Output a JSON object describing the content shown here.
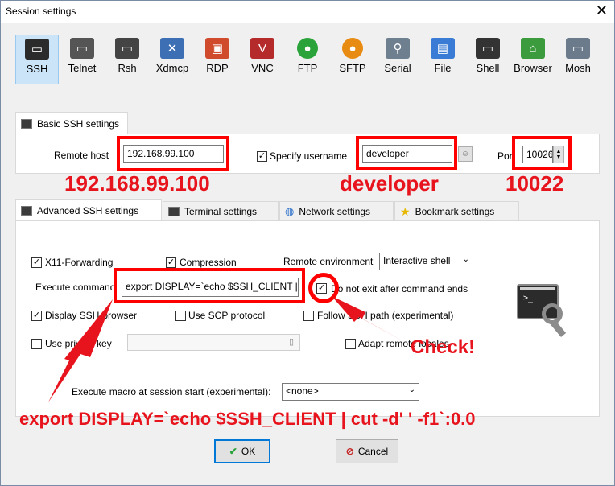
{
  "window": {
    "title": "Session settings",
    "close_glyph": "✕"
  },
  "session_types": [
    {
      "label": "SSH",
      "icon": "ssh-icon",
      "color": "#2b2b2b"
    },
    {
      "label": "Telnet",
      "icon": "telnet-icon",
      "color": "#555555"
    },
    {
      "label": "Rsh",
      "icon": "rsh-icon",
      "color": "#444444"
    },
    {
      "label": "Xdmcp",
      "icon": "xdmcp-icon",
      "color": "#3d6fb5"
    },
    {
      "label": "RDP",
      "icon": "rdp-icon",
      "color": "#d04b2b"
    },
    {
      "label": "VNC",
      "icon": "vnc-icon",
      "color": "#b52a2a"
    },
    {
      "label": "FTP",
      "icon": "ftp-icon",
      "color": "#2aa33a"
    },
    {
      "label": "SFTP",
      "icon": "sftp-icon",
      "color": "#e88b12"
    },
    {
      "label": "Serial",
      "icon": "serial-icon",
      "color": "#6e7f8f"
    },
    {
      "label": "File",
      "icon": "file-icon",
      "color": "#3a7bd5"
    },
    {
      "label": "Shell",
      "icon": "shell-icon",
      "color": "#333333"
    },
    {
      "label": "Browser",
      "icon": "browser-icon",
      "color": "#3c9b3c"
    },
    {
      "label": "Mosh",
      "icon": "mosh-icon",
      "color": "#6b7b8c"
    }
  ],
  "basic": {
    "tab_label": "Basic SSH settings",
    "remote_host_label": "Remote host",
    "remote_host_value": "192.168.99.100",
    "specify_username_label": "Specify username",
    "username_value": "developer",
    "port_label": "Port",
    "port_value": "10026"
  },
  "tabs": [
    "Advanced SSH settings",
    "Terminal settings",
    "Network settings",
    "Bookmark settings"
  ],
  "advanced": {
    "x11_label": "X11-Forwarding",
    "compression_label": "Compression",
    "remote_env_label": "Remote environment",
    "remote_env_value": "Interactive shell",
    "execute_command_label": "Execute command",
    "execute_command_value": "export DISPLAY=`echo $SSH_CLIENT |",
    "do_not_exit_label": "Do not exit after command ends",
    "display_browser_label": "Display SSH-browser",
    "use_scp_label": "Use SCP protocol",
    "follow_path_label": "Follow SSH path (experimental)",
    "use_private_key_label": "Use private key",
    "adapt_locales_label": "Adapt remote locales",
    "macro_label": "Execute macro at session start (experimental):",
    "macro_value": "<none>"
  },
  "buttons": {
    "ok": "OK",
    "cancel": "Cancel"
  },
  "annotations": {
    "ip": "192.168.99.100",
    "user": "developer",
    "port": "10022",
    "check": "Check!",
    "command": "export DISPLAY=`echo $SSH_CLIENT | cut -d' ' -f1`:0.0"
  }
}
